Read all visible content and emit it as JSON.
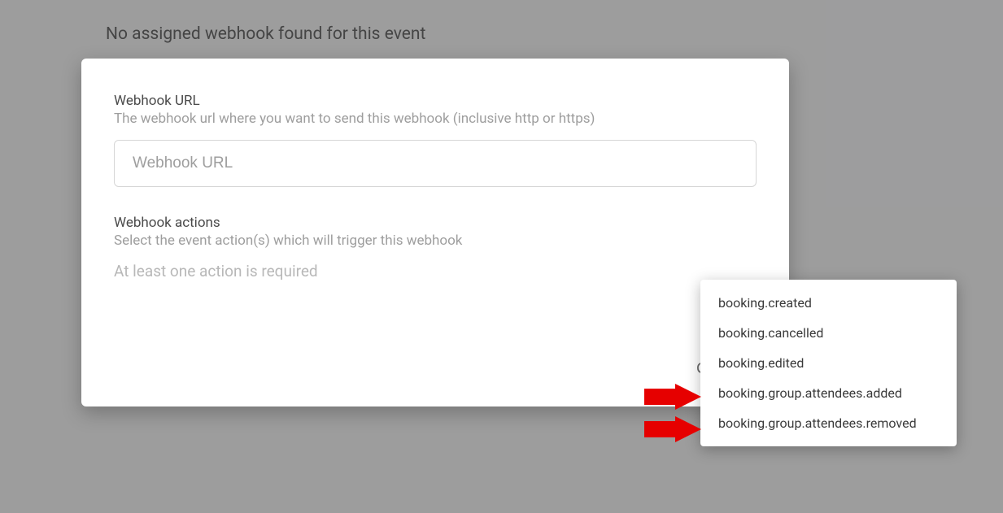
{
  "background": {
    "heading": "No assigned webhook found for this event"
  },
  "modal": {
    "url_label": "Webhook URL",
    "url_desc": "The webhook url where you want to send this webhook (inclusive http or https)",
    "url_placeholder": "Webhook URL",
    "actions_label": "Webhook actions",
    "actions_desc": "Select the event action(s) which will trigger this webhook",
    "validation_msg": "At least one action is required",
    "cancel_label": "Cancel"
  },
  "dropdown": {
    "items": [
      "booking.created",
      "booking.cancelled",
      "booking.edited",
      "booking.group.attendees.added",
      "booking.group.attendees.removed"
    ]
  },
  "annotations": {
    "arrow_color": "#e60000"
  }
}
